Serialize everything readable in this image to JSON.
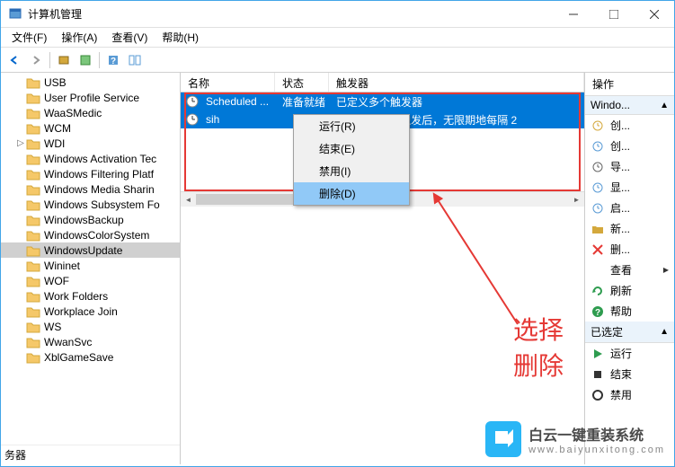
{
  "window": {
    "title": "计算机管理"
  },
  "menu": {
    "file": "文件(F)",
    "action": "操作(A)",
    "view": "查看(V)",
    "help": "帮助(H)"
  },
  "tree": {
    "items": [
      {
        "label": "USB",
        "expand": ""
      },
      {
        "label": "User Profile Service",
        "expand": ""
      },
      {
        "label": "WaaSMedic",
        "expand": ""
      },
      {
        "label": "WCM",
        "expand": ""
      },
      {
        "label": "WDI",
        "expand": "▷"
      },
      {
        "label": "Windows Activation Tec",
        "expand": ""
      },
      {
        "label": "Windows Filtering Platf",
        "expand": ""
      },
      {
        "label": "Windows Media Sharin",
        "expand": ""
      },
      {
        "label": "Windows Subsystem Fo",
        "expand": ""
      },
      {
        "label": "WindowsBackup",
        "expand": ""
      },
      {
        "label": "WindowsColorSystem",
        "expand": ""
      },
      {
        "label": "WindowsUpdate",
        "expand": "",
        "selected": true
      },
      {
        "label": "Wininet",
        "expand": ""
      },
      {
        "label": "WOF",
        "expand": ""
      },
      {
        "label": "Work Folders",
        "expand": ""
      },
      {
        "label": "Workplace Join",
        "expand": ""
      },
      {
        "label": "WS",
        "expand": ""
      },
      {
        "label": "WwanSvc",
        "expand": ""
      },
      {
        "label": "XblGameSave",
        "expand": ""
      }
    ],
    "bottom_label": "务器"
  },
  "list": {
    "headers": {
      "name": "名称",
      "status": "状态",
      "trigger": "触发器"
    },
    "rows": [
      {
        "name": "Scheduled ...",
        "status": "准备就绪",
        "trigger": "已定义多个触发器"
      },
      {
        "name": "sih",
        "status": "",
        "trigger": "| 的 8:00 时 - 触发后，无限期地每隔 2"
      }
    ]
  },
  "context_menu": {
    "run": "运行(R)",
    "end": "结束(E)",
    "disable": "禁用(I)",
    "delete": "删除(D)"
  },
  "annotation": {
    "text": "选择删除"
  },
  "actions": {
    "header": "操作",
    "section1": "Windo...",
    "items1": [
      {
        "icon": "clock-new",
        "label": "创...",
        "color": "#d4a83c"
      },
      {
        "icon": "clock-new2",
        "label": "创...",
        "color": "#5a9bd5"
      },
      {
        "icon": "import",
        "label": "导...",
        "color": "#666"
      },
      {
        "icon": "display",
        "label": "显...",
        "color": "#5a9bd5"
      },
      {
        "icon": "enable",
        "label": "启...",
        "color": "#5a9bd5"
      },
      {
        "icon": "folder-new",
        "label": "新...",
        "color": "#d4a83c"
      },
      {
        "icon": "delete",
        "label": "删...",
        "color": "#e53935"
      }
    ],
    "view": "查看",
    "items2": [
      {
        "icon": "refresh",
        "label": "刷新",
        "color": "#2e9c4f"
      },
      {
        "icon": "help",
        "label": "帮助",
        "color": "#2e9c4f"
      }
    ],
    "section2": "已选定",
    "items3": [
      {
        "icon": "play",
        "label": "运行",
        "color": "#2e9c4f"
      },
      {
        "icon": "stop",
        "label": "结束",
        "color": "#333"
      },
      {
        "icon": "disable",
        "label": "禁用",
        "color": "#333"
      }
    ]
  },
  "watermark": {
    "title": "白云一键重装系统",
    "sub": "www.baiyunxitong.com"
  }
}
